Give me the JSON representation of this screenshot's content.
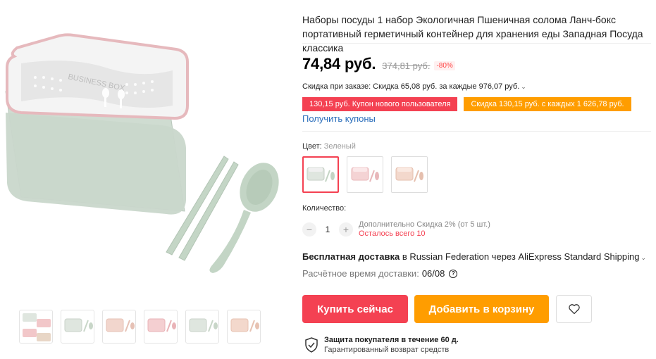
{
  "product": {
    "title": "Наборы посуды 1 набор Экологичная Пшеничная солома Ланч-бокс портативный герметичный контейнер для хранения еды Западная Посуда классика",
    "box_lid_text": "BUSINESS BOX",
    "price": "74,84 руб.",
    "old_price": "374,81 руб.",
    "discount_badge": "-80%",
    "order_discount": "Скидка при заказе: Скидка 65,08 руб. за каждые 976,07 руб.",
    "order_discount_chevron": "⌄",
    "coupons": [
      {
        "label": "130,15 руб. Купон нового пользователя",
        "color": "#f44152"
      },
      {
        "label": "Скидка 130,15 руб. с каждых 1 626,78 руб.",
        "color": "#ff9d00"
      }
    ],
    "get_coupons": "Получить купоны"
  },
  "color": {
    "label": "Цвет:",
    "value": "Зеленый",
    "options": [
      {
        "name": "green",
        "tint": "#dfe6df",
        "selected": true
      },
      {
        "name": "pink",
        "tint": "#f4d3d4",
        "selected": false
      },
      {
        "name": "peach",
        "tint": "#f3d8cc",
        "selected": false
      }
    ]
  },
  "quantity": {
    "label": "Количество:",
    "minus": "−",
    "value": "1",
    "plus": "+",
    "note": "Дополнительно Скидка 2% (от 5 шт.)",
    "stock": "Осталось всего 10"
  },
  "shipping": {
    "free": "Бесплатная доставка",
    "details": "в Russian Federation через AliExpress Standard Shipping",
    "chevron": "⌄",
    "delivery_label": "Расчётное время доставки:",
    "delivery_date": "06/08",
    "help": "?"
  },
  "actions": {
    "buy": "Купить сейчас",
    "cart": "Добавить в корзину"
  },
  "protection": {
    "title": "Защита покупателя в течение 60 д.",
    "subtitle": "Гарантированный возврат средств"
  },
  "gallery": {
    "thumbs": [
      {
        "tint": "#e8e6e0",
        "accent": "#f2c7c9"
      },
      {
        "tint": "#dfe6df",
        "accent": "#dfe6df"
      },
      {
        "tint": "#f2d6cd",
        "accent": "#f2d6cd"
      },
      {
        "tint": "#f4cfd1",
        "accent": "#f4cfd1"
      },
      {
        "tint": "#dfe6df",
        "accent": "#dfe6df"
      },
      {
        "tint": "#f3d8cc",
        "accent": "#f3d8cc"
      }
    ]
  },
  "colors": {
    "red": "#f44152",
    "orange": "#ff9d00",
    "link": "#2a6ebb",
    "product_green": "#cfdcd1"
  }
}
